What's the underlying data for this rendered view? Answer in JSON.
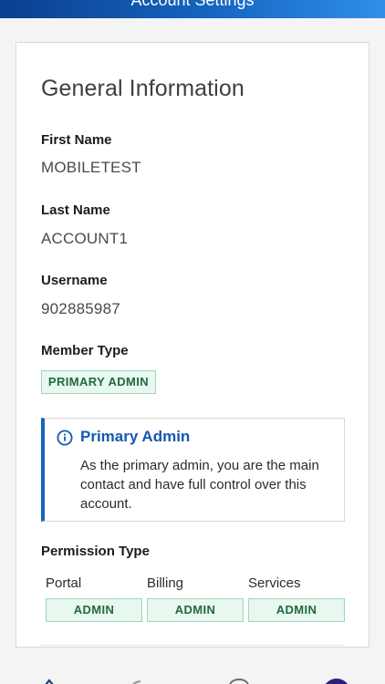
{
  "header": {
    "title": "Account Settings",
    "gradient_start": "#0b3f8f",
    "gradient_end": "#2f8fe8"
  },
  "general": {
    "title": "General Information",
    "first_name": {
      "label": "First Name",
      "value": "MOBILETEST"
    },
    "last_name": {
      "label": "Last Name",
      "value": "ACCOUNT1"
    },
    "username": {
      "label": "Username",
      "value": "902885987"
    },
    "member_type": {
      "label": "Member Type",
      "badge": "PRIMARY ADMIN"
    }
  },
  "info_box": {
    "icon": "info-icon",
    "title": "Primary Admin",
    "text": "As the primary admin, you are the main contact and have full control over this account.",
    "accent": "#1565c0"
  },
  "permissions": {
    "label": "Permission Type",
    "columns": [
      {
        "name": "Portal",
        "value": "ADMIN"
      },
      {
        "name": "Billing",
        "value": "ADMIN"
      },
      {
        "name": "Services",
        "value": "ADMIN"
      }
    ]
  },
  "colors": {
    "badge_bg": "#e8f7ef",
    "badge_border": "#9cd9b8",
    "badge_text": "#1f6b3f"
  },
  "bottom_nav": {
    "icons": [
      "home-icon",
      "phone-icon",
      "help-icon",
      "avatar"
    ]
  }
}
